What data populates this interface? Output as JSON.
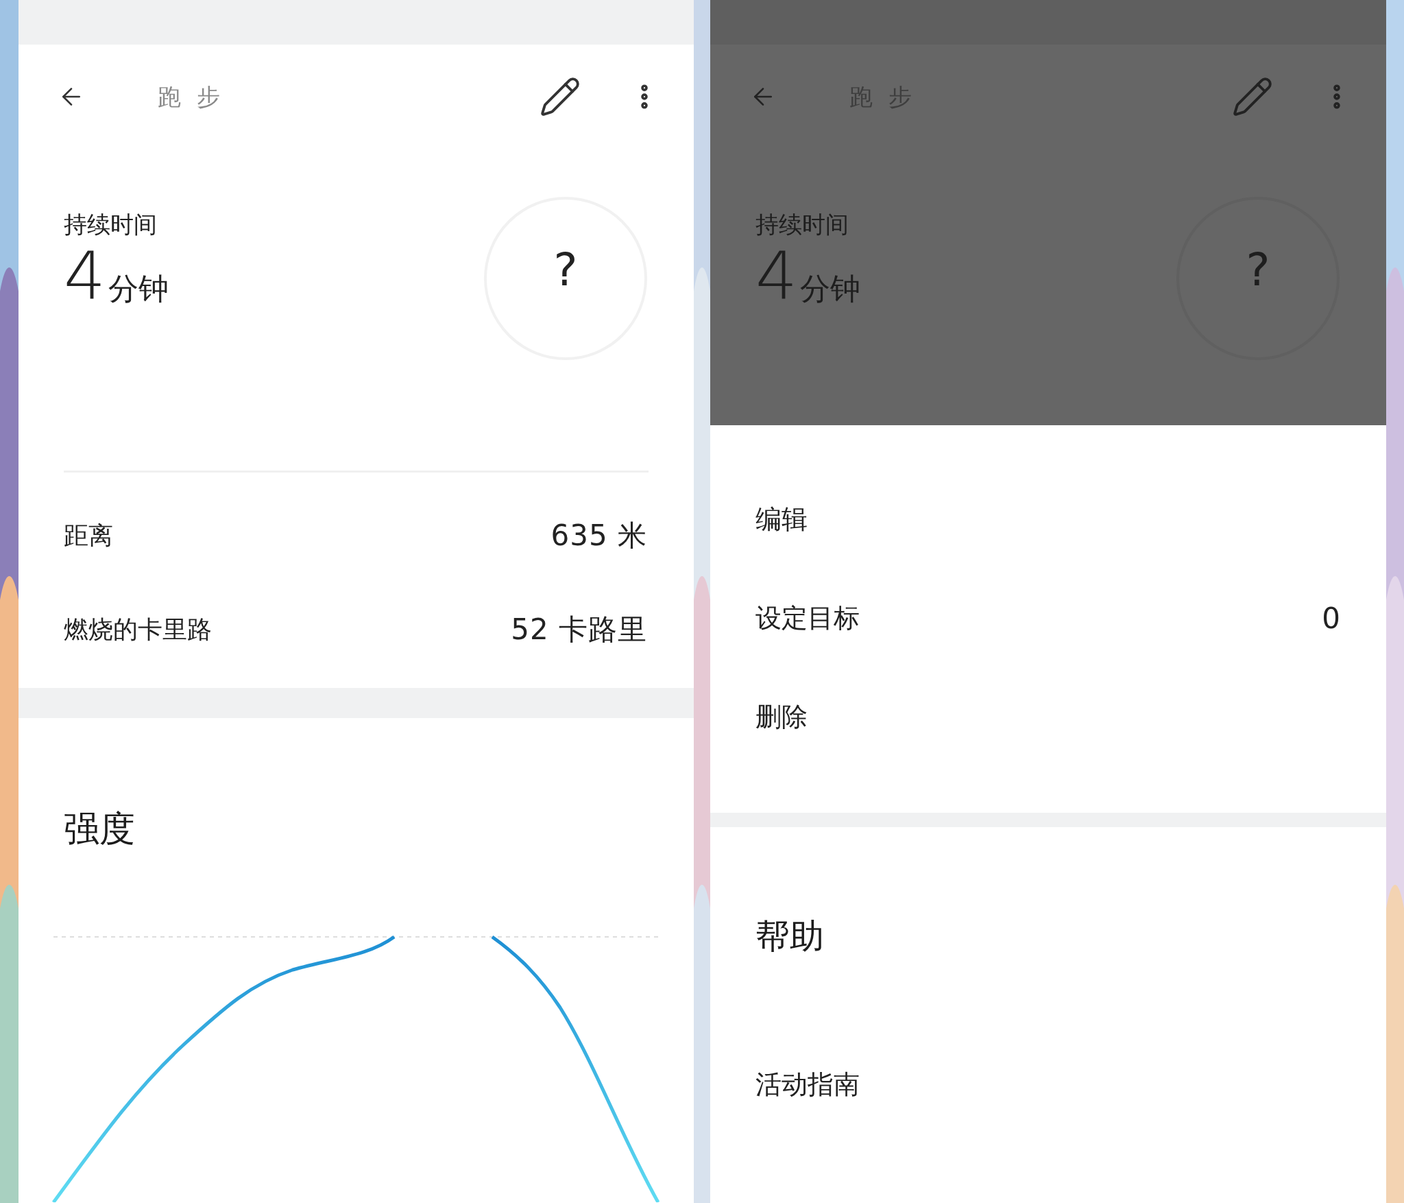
{
  "left_screen": {
    "header": {
      "title": "跑 步",
      "dimmed": false
    },
    "duration": {
      "label": "持续时间",
      "value": "4",
      "unit": "分钟",
      "goal_mark": "?"
    },
    "stats": [
      {
        "label": "距离",
        "value": "635 米"
      },
      {
        "label": "燃烧的卡里路",
        "value": "52 卡路里"
      }
    ],
    "intensity": {
      "title": "强度"
    }
  },
  "right_screen": {
    "header": {
      "title": "跑 步",
      "dimmed": true
    },
    "duration": {
      "label": "持续时间",
      "value": "4",
      "unit": "分钟",
      "goal_mark": "?"
    },
    "menu": [
      {
        "label": "编辑"
      },
      {
        "label": "设定目标",
        "value": "0"
      },
      {
        "label": "删除"
      }
    ],
    "help": {
      "title": "帮助",
      "items": [
        "活动指南"
      ]
    }
  }
}
